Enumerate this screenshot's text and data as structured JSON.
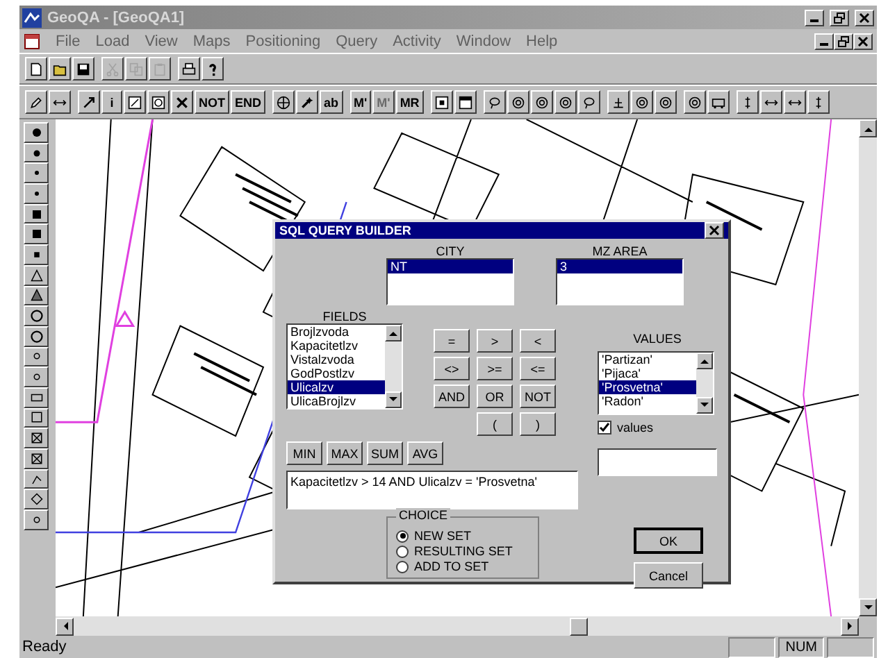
{
  "window": {
    "title": "GeoQA - [GeoQA1]"
  },
  "menu": [
    "File",
    "Load",
    "View",
    "Maps",
    "Positioning",
    "Query",
    "Activity",
    "Window",
    "Help"
  ],
  "toolbar": [
    {
      "disabled": false
    },
    {
      "disabled": false
    },
    {
      "disabled": false
    },
    {
      "disabled": true
    },
    {
      "disabled": true
    },
    {
      "disabled": true
    },
    {
      "disabled": false
    },
    {
      "disabled": false
    }
  ],
  "tools": [
    {
      "label": "i",
      "disabled": false
    },
    {
      "label": "NOT",
      "disabled": false
    },
    {
      "label": "END",
      "disabled": false
    },
    {
      "label": "ab",
      "disabled": false
    },
    {
      "label": "M'",
      "disabled": false
    },
    {
      "label": "M'",
      "disabled": true
    },
    {
      "label": "MR",
      "disabled": false
    }
  ],
  "dialog": {
    "title": "SQL QUERY BUILDER",
    "city": {
      "label": "CITY",
      "items": [
        {
          "text": "NT",
          "selected": true
        }
      ]
    },
    "mz_area": {
      "label": "MZ AREA",
      "items": [
        {
          "text": "3",
          "selected": true
        }
      ]
    },
    "fields": {
      "label": "FIELDS",
      "items": [
        {
          "text": "Brojlzvoda",
          "selected": false
        },
        {
          "text": "Kapacitetlzv",
          "selected": false
        },
        {
          "text": "Vistalzvoda",
          "selected": false
        },
        {
          "text": "GodPostlzv",
          "selected": false
        },
        {
          "text": "Ulicalzv",
          "selected": true
        },
        {
          "text": "UlicaBrojlzv",
          "selected": false
        }
      ]
    },
    "operators": [
      "=",
      ">",
      "<",
      "<>",
      ">=",
      "<=",
      "AND",
      "OR",
      "NOT",
      "(",
      ")"
    ],
    "aggregates": [
      "MIN",
      "MAX",
      "SUM",
      "AVG"
    ],
    "values": {
      "label": "VALUES",
      "items": [
        {
          "text": "'Partizan'",
          "selected": false
        },
        {
          "text": "'Pijaca'",
          "selected": false
        },
        {
          "text": "'Prosvetna'",
          "selected": true
        },
        {
          "text": "'Radon'",
          "selected": false
        }
      ]
    },
    "values_checkbox": {
      "label": "values",
      "checked": true
    },
    "query": "Kapacitetlzv > 14 AND Ulicalzv = 'Prosvetna'",
    "choice": {
      "label": "CHOICE",
      "options": [
        {
          "text": "NEW SET",
          "selected": true
        },
        {
          "text": "RESULTING SET",
          "selected": false
        },
        {
          "text": "ADD TO SET",
          "selected": false
        }
      ]
    },
    "buttons": [
      "OK",
      "Cancel"
    ]
  },
  "status_bar": {
    "text": "Ready",
    "panels": [
      "NUM"
    ]
  }
}
